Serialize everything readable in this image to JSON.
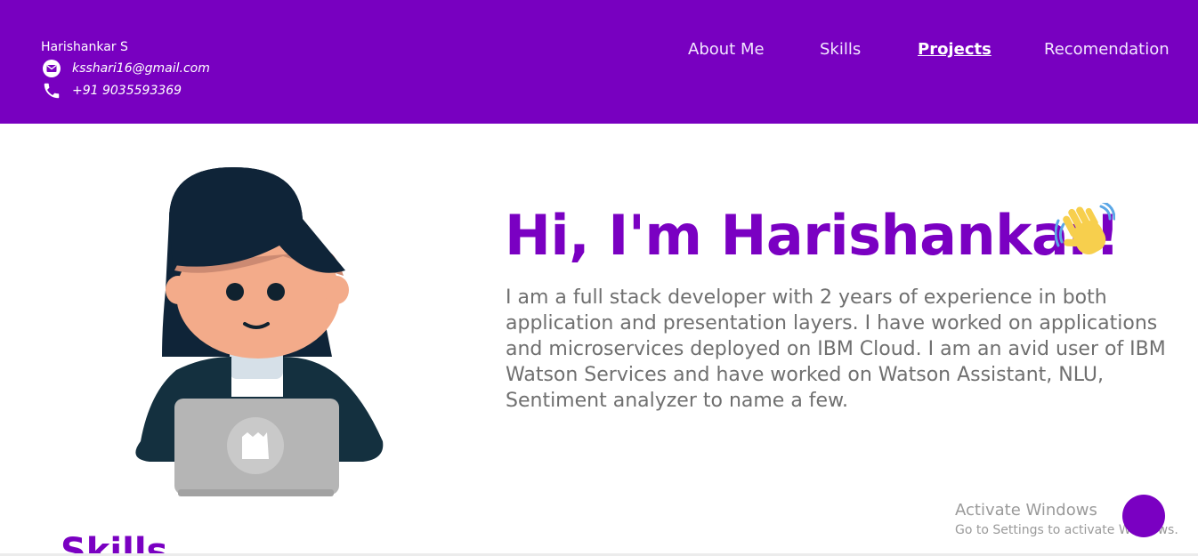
{
  "header": {
    "name": "Harishankar S",
    "email": "ksshari16@gmail.com",
    "phone": "+91 9035593369",
    "bg_color": "#7800c0",
    "icons": {
      "email": "email-icon",
      "phone": "phone-icon"
    }
  },
  "nav": {
    "items": [
      {
        "label": "About Me",
        "active": false
      },
      {
        "label": "Skills",
        "active": false
      },
      {
        "label": "Projects",
        "active": true
      },
      {
        "label": "Recomendation",
        "active": false
      }
    ]
  },
  "hero": {
    "title": "Hi, I'm Harishankar!",
    "title_color": "#7a00c2",
    "wave_icon": "waving-hand-icon",
    "description": "I am a full stack developer with 2 years of experience in both application and presentation layers. I have worked on applications and microservices deployed on IBM Cloud. I am an avid user of IBM Watson Services and have worked on Watson Assistant, NLU, Sentiment analyzer to name a few."
  },
  "next_section": {
    "title": "Skills"
  },
  "watermark": {
    "line1": "Activate Windows",
    "line2": "Go to Settings to activate Windows."
  }
}
